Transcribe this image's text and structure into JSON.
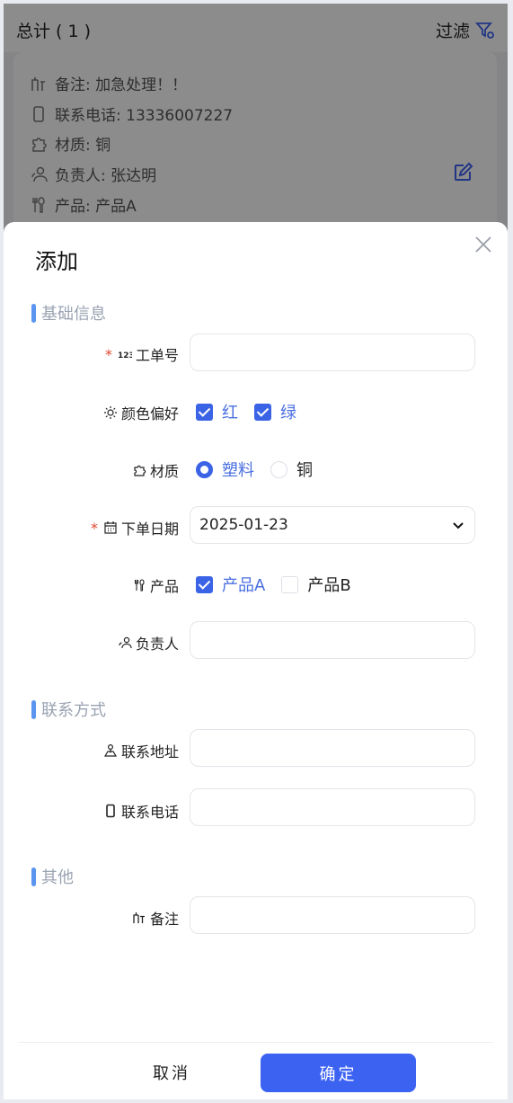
{
  "background": {
    "total_label": "总计 ( 1 )",
    "filter_label": "过滤",
    "card": {
      "remark": "备注: 加急处理！！",
      "phone": "联系电话: 13336007227",
      "material": "材质: 铜",
      "owner": "负责人: 张达明",
      "product": "产品: 产品A"
    }
  },
  "modal": {
    "title": "添加",
    "sections": {
      "basic": "基础信息",
      "contact": "联系方式",
      "other": "其他"
    },
    "fields": {
      "order_no": {
        "label": "工单号",
        "value": "",
        "required": "*"
      },
      "color_pref": {
        "label": "颜色偏好",
        "options": [
          {
            "label": "红",
            "checked": true
          },
          {
            "label": "绿",
            "checked": true
          }
        ]
      },
      "material": {
        "label": "材质",
        "options": [
          {
            "label": "塑料",
            "selected": true
          },
          {
            "label": "铜",
            "selected": false
          }
        ]
      },
      "order_date": {
        "label": "下单日期",
        "value": "2025-01-23",
        "required": "*"
      },
      "product": {
        "label": "产品",
        "options": [
          {
            "label": "产品A",
            "checked": true
          },
          {
            "label": "产品B",
            "checked": false
          }
        ]
      },
      "owner": {
        "label": "负责人",
        "value": ""
      },
      "address": {
        "label": "联系地址",
        "value": ""
      },
      "phone": {
        "label": "联系电话",
        "value": ""
      },
      "remark": {
        "label": "备注",
        "value": ""
      }
    },
    "buttons": {
      "cancel": "取消",
      "confirm": "确定"
    }
  },
  "colors": {
    "primary": "#3c62f2",
    "section_bar": "#5a95f0",
    "required": "#e0452d"
  }
}
